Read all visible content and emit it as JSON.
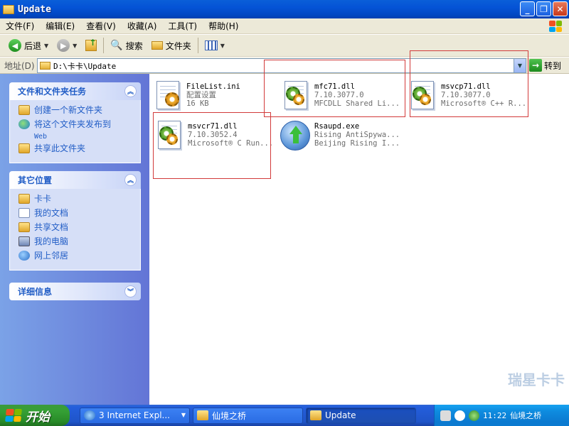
{
  "window": {
    "title": "Update"
  },
  "menu": [
    {
      "label": "文件(F)"
    },
    {
      "label": "编辑(E)"
    },
    {
      "label": "查看(V)"
    },
    {
      "label": "收藏(A)"
    },
    {
      "label": "工具(T)"
    },
    {
      "label": "帮助(H)"
    }
  ],
  "toolbar": {
    "back": "后退",
    "search": "搜索",
    "folders": "文件夹"
  },
  "address": {
    "label": "地址(D)",
    "path": "D:\\卡卡\\Update",
    "go": "转到"
  },
  "sidebar": {
    "tasks": {
      "title": "文件和文件夹任务",
      "items": [
        {
          "label": "创建一个新文件夹",
          "icon": "new-folder-icon"
        },
        {
          "label": "将这个文件夹发布到",
          "sub": "Web",
          "icon": "publish-web-icon"
        },
        {
          "label": "共享此文件夹",
          "icon": "share-folder-icon"
        }
      ]
    },
    "places": {
      "title": "其它位置",
      "items": [
        {
          "label": "卡卡",
          "icon": "folder-icon"
        },
        {
          "label": "我的文档",
          "icon": "my-documents-icon"
        },
        {
          "label": "共享文档",
          "icon": "shared-documents-icon"
        },
        {
          "label": "我的电脑",
          "icon": "my-computer-icon"
        },
        {
          "label": "网上邻居",
          "icon": "network-places-icon"
        }
      ]
    },
    "details": {
      "title": "详细信息"
    }
  },
  "files": [
    {
      "name": "FileList.ini",
      "line2": "配置设置",
      "line3": "16 KB",
      "icon": "config-settings-icon"
    },
    {
      "name": "mfc71.dll",
      "line2": "7.10.3077.0",
      "line3": "MFCDLL Shared Li...",
      "icon": "dll-file-icon"
    },
    {
      "name": "msvcp71.dll",
      "line2": "7.10.3077.0",
      "line3": "Microsoft® C++ R...",
      "icon": "dll-file-icon"
    },
    {
      "name": "msvcr71.dll",
      "line2": "7.10.3052.4",
      "line3": "Microsoft® C Run...",
      "icon": "dll-file-icon"
    },
    {
      "name": "Rsaupd.exe",
      "line2": "Rising AntiSpywa...",
      "line3": "Beijing Rising I...",
      "icon": "rising-update-icon"
    }
  ],
  "watermark": "瑞星卡卡",
  "taskbar": {
    "start": "开始",
    "tasks": [
      {
        "label": "3 Internet Expl..."
      },
      {
        "label": "仙境之桥"
      },
      {
        "label": "Update"
      }
    ],
    "time": "11:22",
    "tray_text": "仙境之桥"
  },
  "colors": {
    "titlebar": "#0553d6",
    "taskpane": "#6375d6",
    "highlight_box": "#d23a3a",
    "start": "#35a035"
  }
}
